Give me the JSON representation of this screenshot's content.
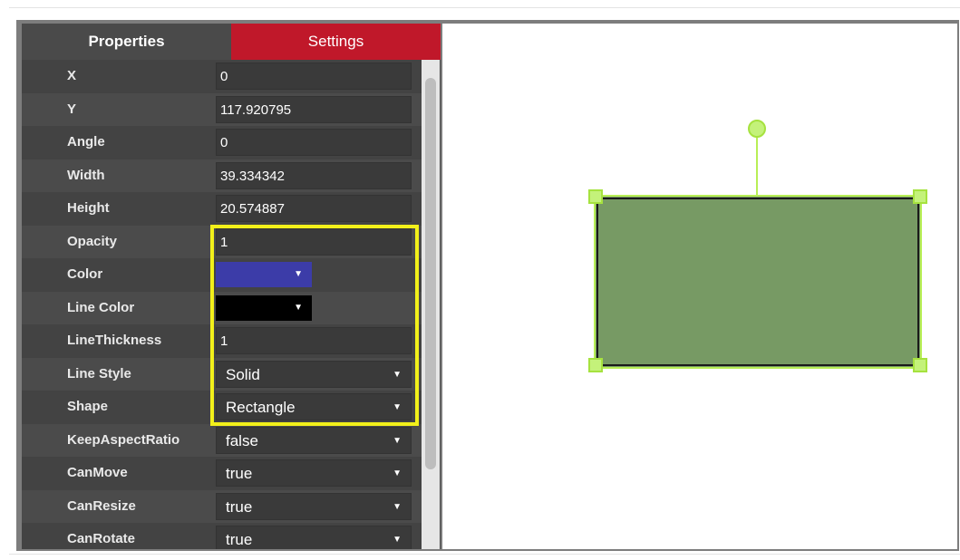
{
  "tabs": {
    "properties_label": "Properties",
    "settings_label": "Settings"
  },
  "properties": [
    {
      "label": "X",
      "kind": "text",
      "value": "0"
    },
    {
      "label": "Y",
      "kind": "text",
      "value": "117.920795"
    },
    {
      "label": "Angle",
      "kind": "text",
      "value": "0"
    },
    {
      "label": "Width",
      "kind": "text",
      "value": "39.334342"
    },
    {
      "label": "Height",
      "kind": "text",
      "value": "20.574887"
    },
    {
      "label": "Opacity",
      "kind": "text",
      "value": "1"
    },
    {
      "label": "Color",
      "kind": "color",
      "color": "#3c3ca8"
    },
    {
      "label": "Line Color",
      "kind": "color",
      "color": "#000000"
    },
    {
      "label": "LineThickness",
      "kind": "text",
      "value": "1"
    },
    {
      "label": "Line Style",
      "kind": "select",
      "value": "Solid"
    },
    {
      "label": "Shape",
      "kind": "select",
      "value": "Rectangle"
    },
    {
      "label": "KeepAspectRatio",
      "kind": "select",
      "value": "false"
    },
    {
      "label": "CanMove",
      "kind": "select",
      "value": "true"
    },
    {
      "label": "CanResize",
      "kind": "select",
      "value": "true"
    },
    {
      "label": "CanRotate",
      "kind": "select",
      "value": "true"
    }
  ],
  "colors": {
    "settings_tab": "#c0182a",
    "highlight": "#f2f01a",
    "shape_fill": "#779a64",
    "selection_handles": "#b8ef55"
  },
  "icons": {
    "caret": "triangle-down-icon"
  }
}
